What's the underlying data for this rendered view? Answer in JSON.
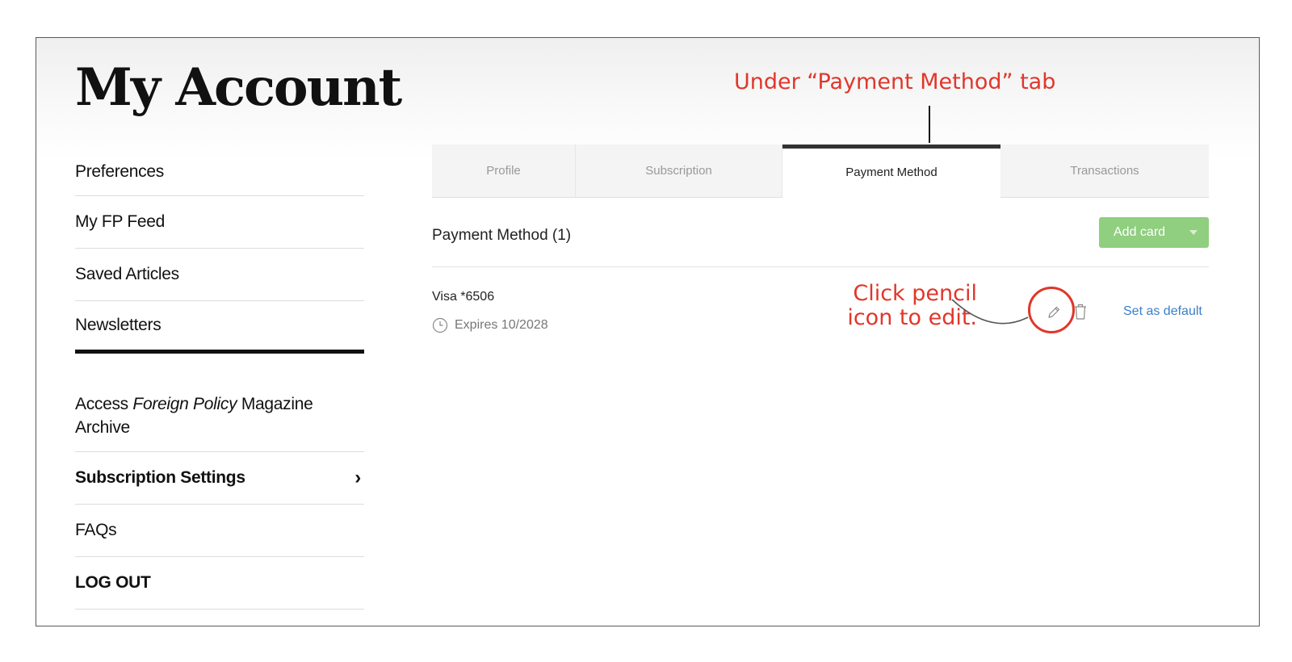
{
  "header": {
    "title": "My Account"
  },
  "sidebar": {
    "items": [
      {
        "label": "Preferences"
      },
      {
        "label": "My FP Feed"
      },
      {
        "label": "Saved Articles"
      },
      {
        "label": "Newsletters"
      }
    ],
    "archive": {
      "pre": "Access ",
      "italic": "Foreign Policy",
      "post": " Magazine Archive"
    },
    "subscription_settings": {
      "label": "Subscription Settings",
      "chevron": "›"
    },
    "faqs": {
      "label": "FAQs"
    },
    "logout": {
      "label": "LOG OUT"
    }
  },
  "tabs": [
    {
      "label": "Profile",
      "active": false
    },
    {
      "label": "Subscription",
      "active": false
    },
    {
      "label": "Payment Method",
      "active": true
    },
    {
      "label": "Transactions",
      "active": false
    }
  ],
  "payment": {
    "title": "Payment Method (1)",
    "add_card_label": "Add card",
    "card": {
      "name": "Visa *6506",
      "expiry": "Expires 10/2028"
    },
    "set_default_label": "Set as default",
    "icons": [
      "clock-icon",
      "pencil-icon",
      "trash-icon",
      "caret-down-icon"
    ]
  },
  "annotations": {
    "tab_note": "Under “Payment Method” tab",
    "pencil_note_line1": "Click pencil",
    "pencil_note_line2": "icon to edit."
  },
  "colors": {
    "annotation": "#e0372a",
    "add_card_button": "#8fcf7f",
    "link": "#3a7fc8",
    "active_tab_border": "#333333"
  }
}
